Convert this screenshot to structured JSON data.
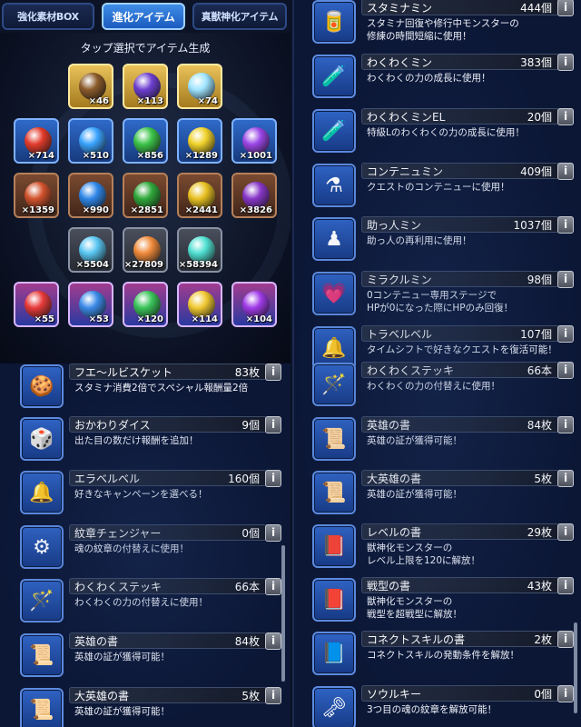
{
  "tabs": {
    "box": "強化素材BOX",
    "evolve": "進化アイテム",
    "beast": "真獣神化アイテム"
  },
  "hint": "タップ選択でアイテム生成",
  "grid": [
    {
      "count": "×46",
      "style": "gold",
      "color": "#8a5a2a"
    },
    {
      "count": "×113",
      "style": "gold",
      "color": "#6d3fd0"
    },
    {
      "count": "×74",
      "style": "gold",
      "color": "#9fe4ff"
    },
    {
      "count": "×714",
      "style": "blue",
      "color": "#e23b2b"
    },
    {
      "count": "×510",
      "style": "blue",
      "color": "#39a3ff"
    },
    {
      "count": "×856",
      "style": "blue",
      "color": "#3cc44a"
    },
    {
      "count": "×1289",
      "style": "blue",
      "color": "#f0d22a"
    },
    {
      "count": "×1001",
      "style": "blue",
      "color": "#9a45e6"
    },
    {
      "count": "×1359",
      "style": "brown",
      "color": "#d2522c"
    },
    {
      "count": "×990",
      "style": "brown",
      "color": "#2e86e8"
    },
    {
      "count": "×2851",
      "style": "brown",
      "color": "#2fa83a"
    },
    {
      "count": "×2441",
      "style": "brown",
      "color": "#e8c020"
    },
    {
      "count": "×3826",
      "style": "brown",
      "color": "#8736c8"
    },
    {
      "count": "×5504",
      "style": "dark",
      "color": "#59c6f2"
    },
    {
      "count": "×27809",
      "style": "dark",
      "color": "#f08a3a"
    },
    {
      "count": "×58394",
      "style": "dark",
      "color": "#4fe0d2"
    },
    {
      "count": "×55",
      "style": "multi",
      "color": "#e83a3a"
    },
    {
      "count": "×53",
      "style": "multi",
      "color": "#3a8ae8"
    },
    {
      "count": "×120",
      "style": "multi",
      "color": "#3ac45a"
    },
    {
      "count": "×114",
      "style": "multi",
      "color": "#f0c830"
    },
    {
      "count": "×104",
      "style": "multi",
      "color": "#a03ae8"
    }
  ],
  "left_list": [
    {
      "name": "フエ～ルビスケット",
      "qty": "83枚",
      "desc": "スタミナ消費2倍でスペシャル報酬量2倍",
      "icon": "biscuit-icon",
      "glyph": "🍪"
    },
    {
      "name": "おかわりダイス",
      "qty": "9個",
      "desc": "出た目の数だけ報酬を追加！",
      "icon": "dice-icon",
      "glyph": "🎲"
    },
    {
      "name": "エラベルベル",
      "qty": "160個",
      "desc": "好きなキャンペーンを選べる！",
      "icon": "bell-icon",
      "glyph": "🔔"
    },
    {
      "name": "紋章チェンジャー",
      "qty": "0個",
      "desc": "魂の紋章の付替えに使用！",
      "icon": "emblem-changer-icon",
      "glyph": "⚙"
    },
    {
      "name": "わくわくステッキ",
      "qty": "66本",
      "desc": "わくわくの力の付替えに使用！",
      "icon": "wand-icon",
      "glyph": "🪄"
    },
    {
      "name": "英雄の書",
      "qty": "84枚",
      "desc": "英雄の証が獲得可能！",
      "icon": "hero-book-icon",
      "glyph": "📜"
    },
    {
      "name": "大英雄の書",
      "qty": "5枚",
      "desc": "英雄の証が獲得可能！",
      "icon": "great-hero-book-icon",
      "glyph": "📜"
    }
  ],
  "right_list": [
    {
      "name": "スタミナミン",
      "qty": "444個",
      "desc": "スタミナ回復や修行中モンスターの\n修練の時間短縮に使用！",
      "icon": "stamina-can-icon",
      "glyph": "🥫"
    },
    {
      "name": "わくわくミン",
      "qty": "383個",
      "desc": "わくわくの力の成長に使用！",
      "icon": "bottle-icon",
      "glyph": "🧪"
    },
    {
      "name": "わくわくミンEL",
      "qty": "20個",
      "desc": "特級Lのわくわくの力の成長に使用！",
      "icon": "bottle-el-icon",
      "glyph": "🧪"
    },
    {
      "name": "コンテニュミン",
      "qty": "409個",
      "desc": "クエストのコンテニューに使用！",
      "icon": "continue-icon",
      "glyph": "⚗"
    },
    {
      "name": "助っ人ミン",
      "qty": "1037個",
      "desc": "助っ人の再利用に使用！",
      "icon": "helper-icon",
      "glyph": "♟"
    },
    {
      "name": "ミラクルミン",
      "qty": "98個",
      "desc": "0コンテニュー専用ステージで\nHPが0になった際にHPのみ回復！",
      "icon": "miracle-icon",
      "glyph": "💗"
    },
    {
      "name": "トラベルベル",
      "qty": "107個",
      "desc": "タイムシフトで好きなクエストを復活可能！",
      "icon": "travel-bell-icon",
      "glyph": "🔔"
    },
    {
      "name": "わくわくステッキ",
      "qty": "66本",
      "desc": "わくわくの力の付替えに使用！",
      "icon": "wand-icon",
      "glyph": "🪄"
    },
    {
      "name": "英雄の書",
      "qty": "84枚",
      "desc": "英雄の証が獲得可能！",
      "icon": "hero-book-icon",
      "glyph": "📜"
    },
    {
      "name": "大英雄の書",
      "qty": "5枚",
      "desc": "英雄の証が獲得可能！",
      "icon": "great-hero-book-icon",
      "glyph": "📜"
    },
    {
      "name": "レベルの書",
      "qty": "29枚",
      "desc": "獣神化モンスターの\nレベル上限を120に解放！",
      "icon": "level-book-icon",
      "glyph": "📕"
    },
    {
      "name": "戦型の書",
      "qty": "43枚",
      "desc": "獣神化モンスターの\n戦型を超戦型に解放！",
      "icon": "battle-type-book-icon",
      "glyph": "📕"
    },
    {
      "name": "コネクトスキルの書",
      "qty": "2枚",
      "desc": "コネクトスキルの発動条件を解放！",
      "icon": "connect-skill-book-icon",
      "glyph": "📘"
    },
    {
      "name": "ソウルキー",
      "qty": "0個",
      "desc": "3つ目の魂の紋章を解放可能！",
      "icon": "soul-key-icon",
      "glyph": "🗝"
    }
  ],
  "info_label": "i"
}
